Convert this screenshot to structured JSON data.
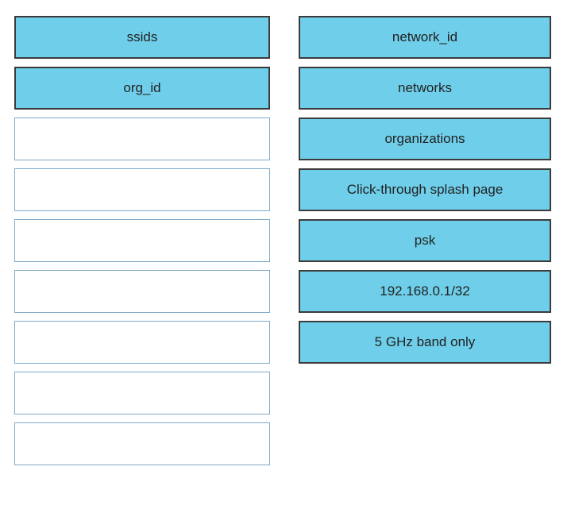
{
  "left": {
    "filled": [
      {
        "label": "ssids"
      },
      {
        "label": "org_id"
      }
    ],
    "empty_count": 7
  },
  "right": {
    "filled": [
      {
        "label": "network_id"
      },
      {
        "label": "networks"
      },
      {
        "label": "organizations"
      },
      {
        "label": "Click-through splash page"
      },
      {
        "label": "psk"
      },
      {
        "label": "192.168.0.1/32"
      },
      {
        "label": "5 GHz band only"
      }
    ]
  }
}
